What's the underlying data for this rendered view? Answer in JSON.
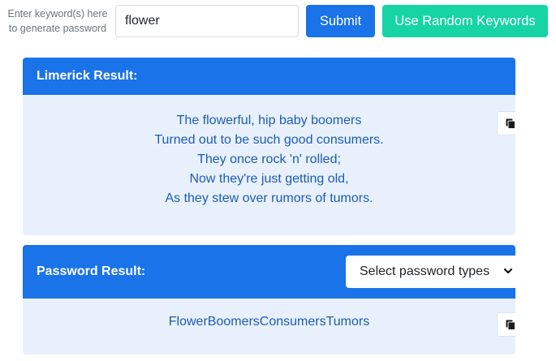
{
  "top": {
    "keyword_label_line1": "Enter keyword(s) here",
    "keyword_label_line2": "to generate password",
    "keyword_value": "flower",
    "submit_label": "Submit",
    "random_label": "Use Random Keywords"
  },
  "limerick": {
    "header": "Limerick Result:",
    "lines": [
      "The flowerful, hip baby boomers",
      "Turned out to be such good consumers.",
      "They once rock 'n' rolled;",
      "Now they're just getting old,",
      "As they stew over rumors of tumors."
    ],
    "copy_icon": "copy-icon"
  },
  "password": {
    "header": "Password Result:",
    "select_label": "Select password types",
    "value": "FlowerBoomersConsumersTumors",
    "copy_icon": "copy-icon"
  },
  "colors": {
    "primary": "#1a73e8",
    "accent": "#16d4a4",
    "panel": "#e8f1fb",
    "result_text": "#1c5bb8"
  }
}
